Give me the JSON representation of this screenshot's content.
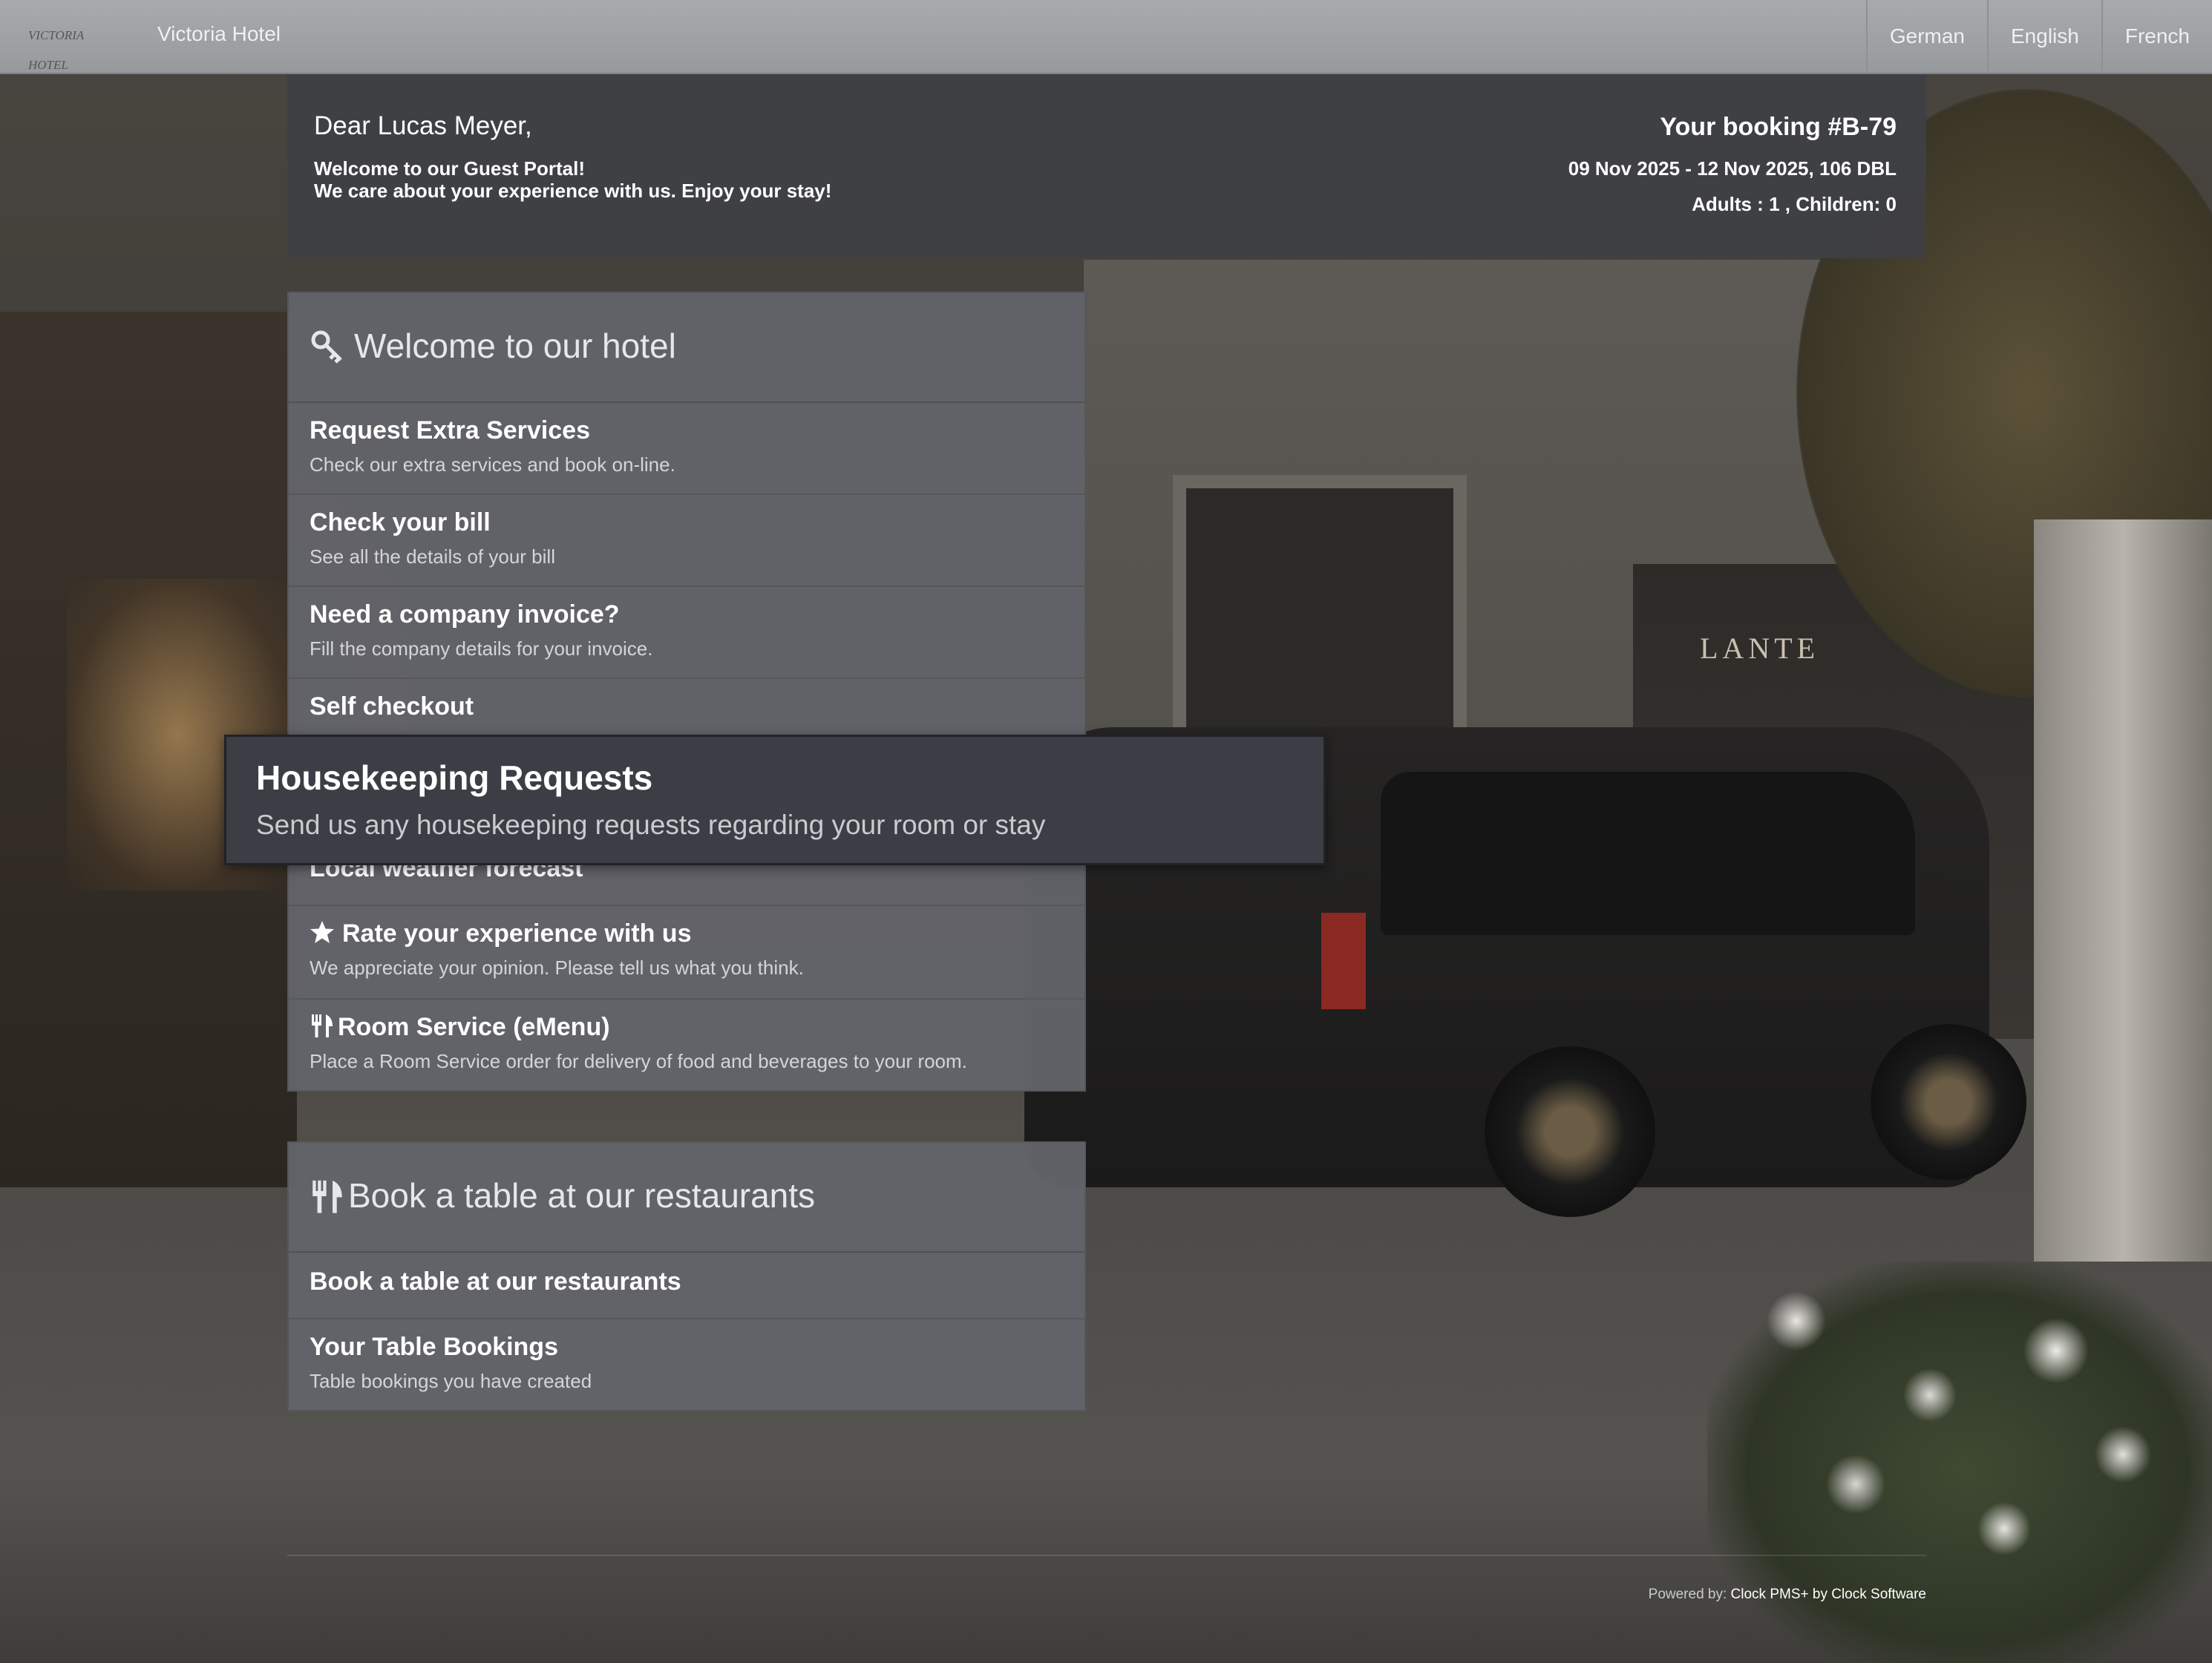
{
  "navbar": {
    "logo_text": "VICTORIA HOTEL",
    "brand": "Victoria Hotel",
    "languages": [
      "German",
      "English",
      "French"
    ]
  },
  "booking": {
    "greeting": "Dear Lucas Meyer,",
    "welcome_line1": "Welcome to our Guest Portal!",
    "welcome_line2": "We care about your experience with us. Enjoy your stay!",
    "booking_number": "Your booking #B-79",
    "dates_room": "09 Nov 2025 - 12 Nov 2025, 106 DBL",
    "guests": "Adults : 1 , Children: 0"
  },
  "hotel_panel": {
    "title": "Welcome to our hotel",
    "icon": "key-icon",
    "items": [
      {
        "title": "Request Extra Services",
        "desc": "Check our extra services and book on-line."
      },
      {
        "title": "Check your bill",
        "desc": "See all the details of your bill"
      },
      {
        "title": "Need a company invoice?",
        "desc": "Fill the company details for your invoice."
      },
      {
        "title": "Self checkout",
        "desc": ""
      },
      {
        "title": "Local weather forecast",
        "desc": ""
      },
      {
        "title": "Rate your experience with us",
        "desc": "We appreciate your opinion. Please tell us what you think.",
        "icon": "star-icon"
      },
      {
        "title": "Room Service (eMenu)",
        "desc": "Place a Room Service order for delivery of food and beverages to your room.",
        "icon": "utensils-icon"
      }
    ]
  },
  "housekeeping_tooltip": {
    "title": "Housekeeping Requests",
    "desc": "Send us any housekeeping requests regarding your room or stay"
  },
  "restaurant_panel": {
    "title": "Book a table at our restaurants",
    "icon": "utensils-icon",
    "items": [
      {
        "title": "Book a table at our restaurants",
        "desc": ""
      },
      {
        "title": "Your Table Bookings",
        "desc": "Table bookings you have created"
      }
    ]
  },
  "scene": {
    "shop_sign": "LANTE"
  },
  "footer": {
    "powered_label": "Powered by:",
    "powered_value": "Clock PMS+ by Clock Software"
  }
}
